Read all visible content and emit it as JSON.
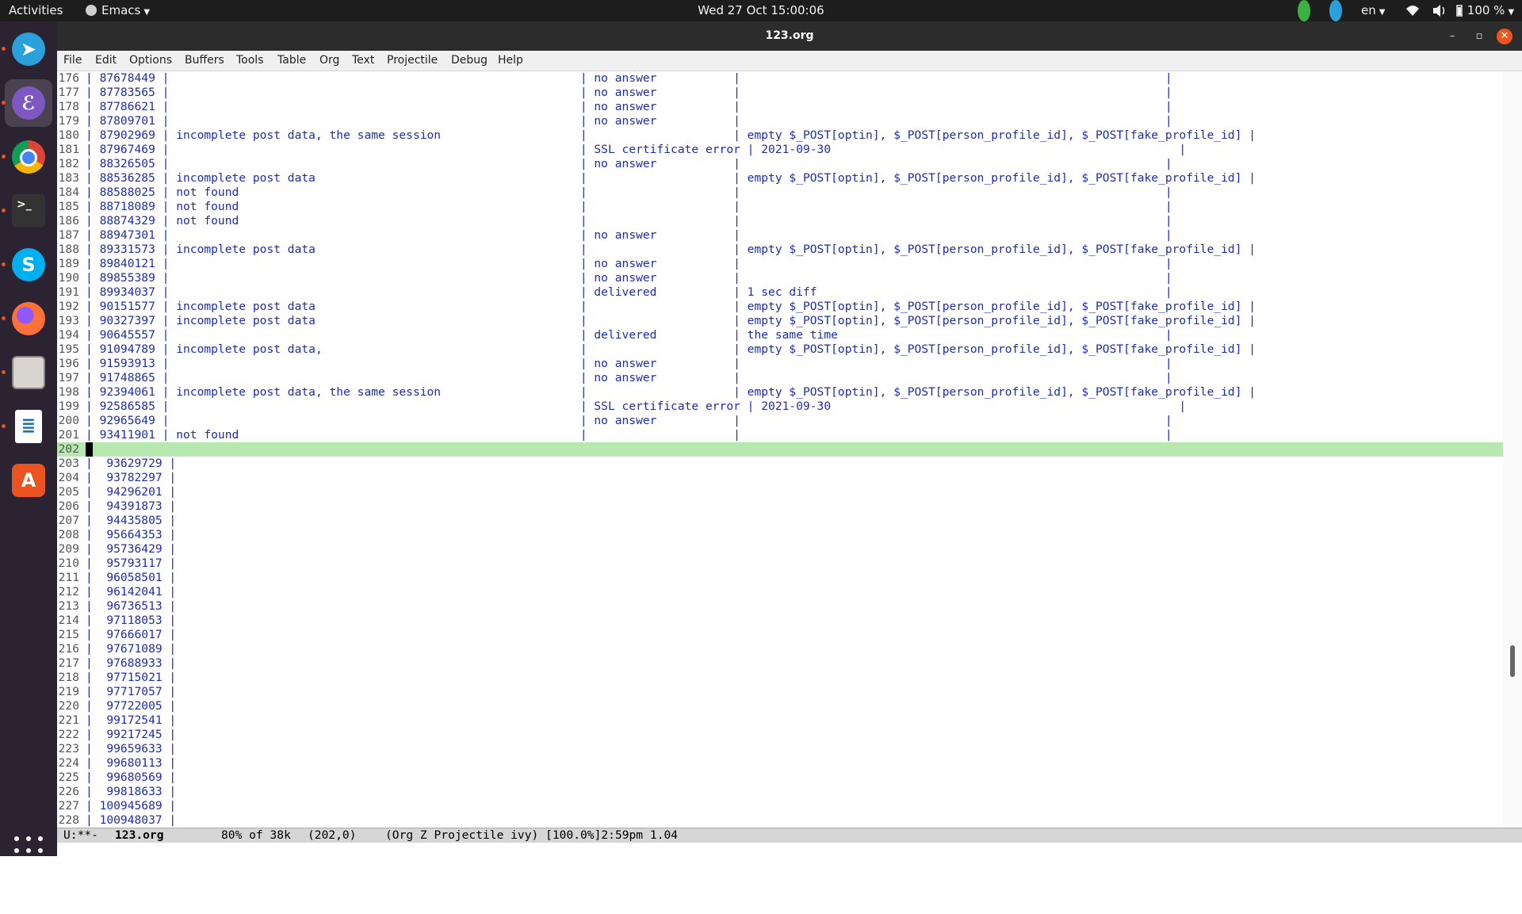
{
  "topbar": {
    "activities": "Activities",
    "app_menu": "Emacs",
    "clock": "Wed 27 Oct  15:00:06",
    "lang": "en",
    "battery": "100 %"
  },
  "dock": {
    "items": [
      {
        "name": "telegram",
        "glyph": "➤",
        "color": "#2aa1da"
      },
      {
        "name": "emacs",
        "glyph": "ℰ",
        "color": "#7e57c2"
      },
      {
        "name": "chrome",
        "glyph": "◉",
        "color": "#db4437"
      },
      {
        "name": "terminal",
        "glyph": ">_",
        "color": "#333333"
      },
      {
        "name": "skype",
        "glyph": "S",
        "color": "#00aff0"
      },
      {
        "name": "firefox",
        "glyph": "●",
        "color": "#ff7139"
      },
      {
        "name": "files",
        "glyph": "▭",
        "color": "#b0aca7"
      },
      {
        "name": "writer",
        "glyph": "≣",
        "color": "#1e6fc8"
      },
      {
        "name": "software",
        "glyph": "A",
        "color": "#e95420"
      }
    ]
  },
  "window": {
    "title": "123.org"
  },
  "menubar": [
    "File",
    "Edit",
    "Options",
    "Buffers",
    "Tools",
    "Table",
    "Org",
    "Text",
    "Projectile",
    "Debug",
    "Help"
  ],
  "editor": {
    "lines": [
      {
        "num": "176",
        "text": "| 87678449 |                                                           | no answer           |                                                             |"
      },
      {
        "num": "177",
        "text": "| 87783565 |                                                           | no answer           |                                                             |"
      },
      {
        "num": "178",
        "text": "| 87786621 |                                                           | no answer           |                                                             |"
      },
      {
        "num": "179",
        "text": "| 87809701 |                                                           | no answer           |                                                             |"
      },
      {
        "num": "180",
        "text": "| 87902969 | incomplete post data, the same session                    |                     | empty $_POST[optin], $_POST[person_profile_id], $_POST[fake_profile_id] |"
      },
      {
        "num": "181",
        "text": "| 87967469 |                                                           | SSL certificate error | 2021-09-30                                                  |"
      },
      {
        "num": "182",
        "text": "| 88326505 |                                                           | no answer           |                                                             |"
      },
      {
        "num": "183",
        "text": "| 88536285 | incomplete post data                                      |                     | empty $_POST[optin], $_POST[person_profile_id], $_POST[fake_profile_id] |"
      },
      {
        "num": "184",
        "text": "| 88588025 | not found                                                 |                     |                                                             |"
      },
      {
        "num": "185",
        "text": "| 88718089 | not found                                                 |                     |                                                             |"
      },
      {
        "num": "186",
        "text": "| 88874329 | not found                                                 |                     |                                                             |"
      },
      {
        "num": "187",
        "text": "| 88947301 |                                                           | no answer           |                                                             |"
      },
      {
        "num": "188",
        "text": "| 89331573 | incomplete post data                                      |                     | empty $_POST[optin], $_POST[person_profile_id], $_POST[fake_profile_id] |"
      },
      {
        "num": "189",
        "text": "| 89840121 |                                                           | no answer           |                                                             |"
      },
      {
        "num": "190",
        "text": "| 89855389 |                                                           | no answer           |                                                             |"
      },
      {
        "num": "191",
        "text": "| 89934037 |                                                           | delivered           | 1 sec diff                                                  |"
      },
      {
        "num": "192",
        "text": "| 90151577 | incomplete post data                                      |                     | empty $_POST[optin], $_POST[person_profile_id], $_POST[fake_profile_id] |"
      },
      {
        "num": "193",
        "text": "| 90327397 | incomplete post data                                      |                     | empty $_POST[optin], $_POST[person_profile_id], $_POST[fake_profile_id] |"
      },
      {
        "num": "194",
        "text": "| 90645557 |                                                           | delivered           | the same time                                               |"
      },
      {
        "num": "195",
        "text": "| 91094789 | incomplete post data,                                     |                     | empty $_POST[optin], $_POST[person_profile_id], $_POST[fake_profile_id] |"
      },
      {
        "num": "196",
        "text": "| 91593913 |                                                           | no answer           |                                                             |"
      },
      {
        "num": "197",
        "text": "| 91748865 |                                                           | no answer           |                                                             |"
      },
      {
        "num": "198",
        "text": "| 92394061 | incomplete post data, the same session                    |                     | empty $_POST[optin], $_POST[person_profile_id], $_POST[fake_profile_id] |"
      },
      {
        "num": "199",
        "text": "| 92586585 |                                                           | SSL certificate error | 2021-09-30                                                  |"
      },
      {
        "num": "200",
        "text": "| 92965649 |                                                           | no answer           |                                                             |"
      },
      {
        "num": "201",
        "text": "| 93411901 | not found                                                 |                     |                                                             |"
      },
      {
        "num": "202",
        "text": ""
      },
      {
        "num": "203",
        "text": "|  93629729 |"
      },
      {
        "num": "204",
        "text": "|  93782297 |"
      },
      {
        "num": "205",
        "text": "|  94296201 |"
      },
      {
        "num": "206",
        "text": "|  94391873 |"
      },
      {
        "num": "207",
        "text": "|  94435805 |"
      },
      {
        "num": "208",
        "text": "|  95664353 |"
      },
      {
        "num": "209",
        "text": "|  95736429 |"
      },
      {
        "num": "210",
        "text": "|  95793117 |"
      },
      {
        "num": "211",
        "text": "|  96058501 |"
      },
      {
        "num": "212",
        "text": "|  96142041 |"
      },
      {
        "num": "213",
        "text": "|  96736513 |"
      },
      {
        "num": "214",
        "text": "|  97118053 |"
      },
      {
        "num": "215",
        "text": "|  97666017 |"
      },
      {
        "num": "216",
        "text": "|  97671089 |"
      },
      {
        "num": "217",
        "text": "|  97688933 |"
      },
      {
        "num": "218",
        "text": "|  97715021 |"
      },
      {
        "num": "219",
        "text": "|  97717057 |"
      },
      {
        "num": "220",
        "text": "|  97722005 |"
      },
      {
        "num": "221",
        "text": "|  99172541 |"
      },
      {
        "num": "222",
        "text": "|  99217245 |"
      },
      {
        "num": "223",
        "text": "|  99659633 |"
      },
      {
        "num": "224",
        "text": "|  99680113 |"
      },
      {
        "num": "225",
        "text": "|  99680569 |"
      },
      {
        "num": "226",
        "text": "|  99818633 |"
      },
      {
        "num": "227",
        "text": "| 100945689 |"
      },
      {
        "num": "228",
        "text": "| 100948037 |"
      }
    ],
    "current_line": "202"
  },
  "modeline": {
    "status": "U:**-",
    "buffer": "123.org",
    "position": "80% of 38k",
    "cursor": "(202,0)",
    "modes": "(Org Z Projectile ivy) [100.0%]2:59pm 1.04"
  }
}
